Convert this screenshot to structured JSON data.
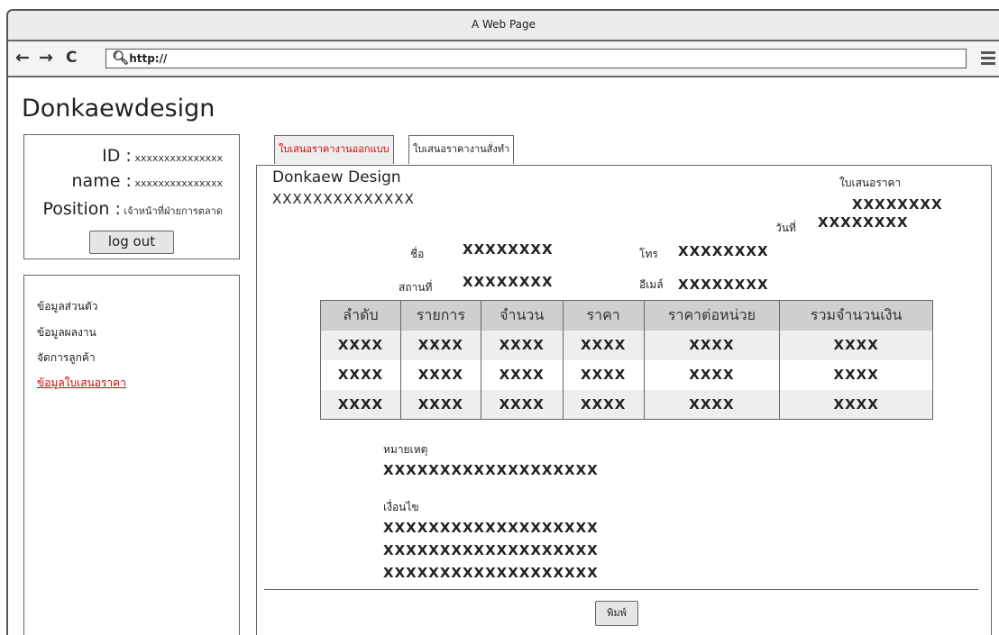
{
  "window": {
    "title": "A Web Page"
  },
  "navbar": {
    "back": "←",
    "forward": "→",
    "reload": "C",
    "url": "http://"
  },
  "brand": "Donkaewdesign",
  "user": {
    "id_label": "ID :",
    "id_value": "xxxxxxxxxxxxxxx",
    "name_label": "name :",
    "name_value": "xxxxxxxxxxxxxxx",
    "position_label": "Position :",
    "position_value": "เจ้าหน้าที่ฝ่ายการตลาด",
    "logout": "log out"
  },
  "sidebar": {
    "items": [
      {
        "label": "ข้อมูลส่วนตัว"
      },
      {
        "label": "ข้อมูลผลงาน"
      },
      {
        "label": "จัดการลูกค้า"
      },
      {
        "label": "ข้อมูลใบเสนอราคา"
      }
    ]
  },
  "tabs": [
    {
      "label": "ใบเสนอราคางานออกแบบ"
    },
    {
      "label": "ใบเสนอราคางานสั่งทำ"
    }
  ],
  "document": {
    "company": "Donkaew Design",
    "company_sub": "XXXXXXXXXXXXXX",
    "type": "ใบเสนอราคา",
    "number": "XXXXXXXX",
    "date_label": "วันที่",
    "date_value": "XXXXXXXX",
    "name_label": "ชื่อ",
    "name_value": "XXXXXXXX",
    "phone_label": "โทร",
    "phone_value": "XXXXXXXX",
    "place_label": "สถานที่",
    "place_value": "XXXXXXXX",
    "email_label": "อีเมล์",
    "email_value": "XXXXXXXX",
    "table": {
      "headers": [
        "ลำดับ",
        "รายการ",
        "จำนวน",
        "ราคา",
        "ราคาต่อหน่วย",
        "รวมจำนวนเงิน"
      ],
      "rows": [
        [
          "XXXX",
          "XXXX",
          "XXXX",
          "XXXX",
          "XXXX",
          "XXXX"
        ],
        [
          "XXXX",
          "XXXX",
          "XXXX",
          "XXXX",
          "XXXX",
          "XXXX"
        ],
        [
          "XXXX",
          "XXXX",
          "XXXX",
          "XXXX",
          "XXXX",
          "XXXX"
        ]
      ]
    },
    "remark_label": "หมายเหตุ",
    "remark_value": "XXXXXXXXXXXXXXXXXXX",
    "condition_label": "เงื่อนไข",
    "condition_lines": [
      "XXXXXXXXXXXXXXXXXXX",
      "XXXXXXXXXXXXXXXXXXX",
      "XXXXXXXXXXXXXXXXXXX"
    ],
    "print": "พิมพ์"
  },
  "colors": {
    "active_link": "#dd0000",
    "table_header": "#cfcfcf",
    "border": "#666666"
  }
}
